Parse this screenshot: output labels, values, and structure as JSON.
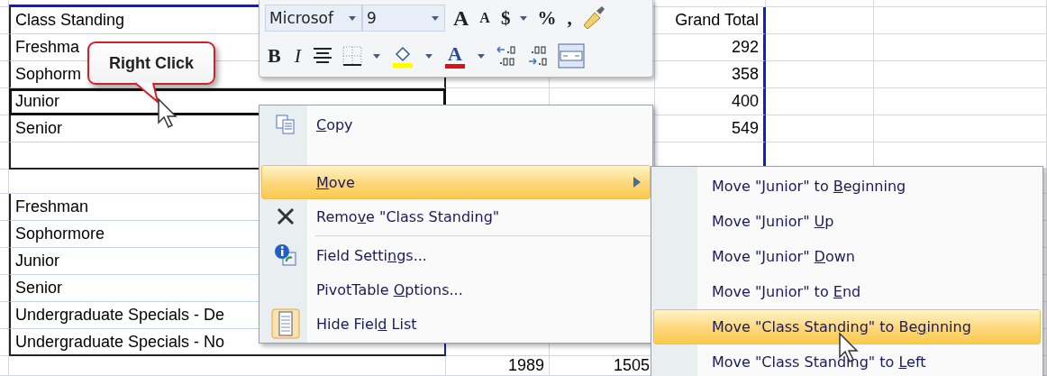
{
  "sheet": {
    "upper_rows": [
      {
        "label": "Class Standing",
        "grand_total": "Grand Total",
        "selected": false
      },
      {
        "label": "Freshma",
        "grand_total": "292",
        "selected": false
      },
      {
        "label": "Sophorm",
        "grand_total": "358",
        "selected": false
      },
      {
        "label": "Junior",
        "grand_total": "400",
        "selected": true
      },
      {
        "label": "Senior",
        "grand_total": "549",
        "selected": false
      }
    ],
    "lower_rows": [
      {
        "label": "Freshman"
      },
      {
        "label": "Sophormore"
      },
      {
        "label": "Junior"
      },
      {
        "label": "Senior"
      },
      {
        "label": "Undergraduate Specials - De"
      },
      {
        "label": "Undergraduate Specials - No"
      }
    ],
    "totals": [
      "1989",
      "1505"
    ]
  },
  "callout": {
    "text": "Right Click"
  },
  "mini_toolbar": {
    "font": "Microsof",
    "size": "9",
    "row1": [
      {
        "kind": "grow-font",
        "label": "A"
      },
      {
        "kind": "shrink-font",
        "label": "A"
      },
      {
        "kind": "text",
        "label": "$"
      },
      {
        "kind": "dropdown"
      },
      {
        "kind": "text",
        "label": "%"
      },
      {
        "kind": "text",
        "label": ","
      },
      {
        "kind": "painter"
      }
    ],
    "row2": [
      {
        "kind": "bold",
        "label": "B"
      },
      {
        "kind": "italic",
        "label": "I"
      },
      {
        "kind": "align"
      },
      {
        "kind": "borders"
      },
      {
        "kind": "dropdown"
      },
      {
        "kind": "fill",
        "color": "#ffff00"
      },
      {
        "kind": "dropdown"
      },
      {
        "kind": "font-color",
        "label": "A",
        "color": "#e01010"
      },
      {
        "kind": "dropdown"
      },
      {
        "kind": "inc-decimal"
      },
      {
        "kind": "dec-decimal"
      },
      {
        "kind": "merge"
      }
    ]
  },
  "context_menu": {
    "items": [
      {
        "kind": "copy",
        "key": "C",
        "after": "opy",
        "selected": false,
        "submenu": false
      },
      {
        "kind": "gap"
      },
      {
        "kind": "plain",
        "key": "M",
        "after": "ove",
        "selected": true,
        "submenu": true
      },
      {
        "kind": "remove",
        "before": "Remo",
        "key": "v",
        "after": "e \"Class Standing\"",
        "selected": false,
        "submenu": false
      },
      {
        "kind": "separator"
      },
      {
        "kind": "settings",
        "before": "Field Setti",
        "key": "n",
        "after": "gs...",
        "selected": false,
        "submenu": false
      },
      {
        "kind": "plain",
        "before": "PivotTable ",
        "key": "O",
        "after": "ptions...",
        "selected": false,
        "submenu": false
      },
      {
        "kind": "field-list",
        "before": "Hide Fiel",
        "key": "d",
        "after": " List",
        "selected": false,
        "submenu": false
      }
    ]
  },
  "submenu": {
    "items": [
      {
        "before": "Move \"Junior\" to ",
        "key": "B",
        "after": "eginning",
        "selected": false
      },
      {
        "before": "Move \"Junior\" ",
        "key": "U",
        "after": "p",
        "selected": false
      },
      {
        "before": "Move \"Junior\" ",
        "key": "D",
        "after": "own",
        "selected": false
      },
      {
        "before": "Move \"Junior\" to ",
        "key": "E",
        "after": "nd",
        "selected": false
      },
      {
        "before": "Move \"Class Standing\" to Be",
        "key": "g",
        "after": "inning",
        "selected": true
      },
      {
        "before": "Move \"Class Standing\" to ",
        "key": "L",
        "after": "eft",
        "selected": false
      }
    ]
  }
}
